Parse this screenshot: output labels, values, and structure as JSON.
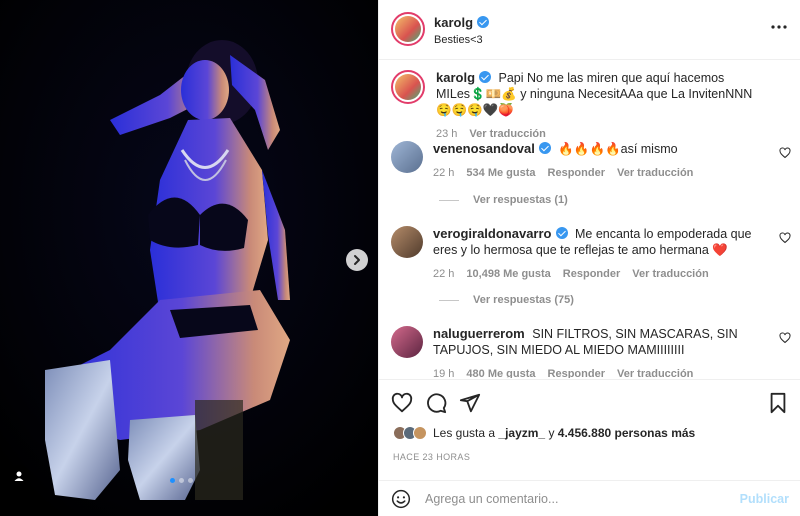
{
  "post": {
    "author": "karolg",
    "subtitle": "Besties<3",
    "caption_text": "Papi No me las miren que aquí hacemos MILes💲💴💰 y ninguna NecesitAAa que La InvitenNNN 🤤🤤🤤🖤🍑",
    "caption_time": "23 h",
    "translate_label": "Ver traducción"
  },
  "comments": [
    {
      "user": "venenosandoval",
      "text": "🔥🔥🔥🔥así mismo",
      "time": "22 h",
      "likes": "534 Me gusta",
      "reply_label": "Responder",
      "translate_label": "Ver traducción",
      "replies_label": "Ver respuestas (1)"
    },
    {
      "user": "verogiraldonavarro",
      "text": "Me encanta lo empoderada que eres y lo hermosa que te reflejas te amo hermana ❤️",
      "time": "22 h",
      "likes": "10,498 Me gusta",
      "reply_label": "Responder",
      "translate_label": "Ver traducción",
      "replies_label": "Ver respuestas (75)"
    },
    {
      "user": "naluguerrerom",
      "text": "SIN FILTROS, SIN MASCARAS, SIN TAPUJOS, SIN MIEDO AL MIEDO MAMIIIIIIII",
      "time": "19 h",
      "likes": "480 Me gusta",
      "reply_label": "Responder",
      "translate_label": "Ver traducción"
    }
  ],
  "likes": {
    "prefix": "Les gusta a",
    "user": "_jayzm_",
    "conj": "y",
    "others": "4.456.880 personas más"
  },
  "time_ago": "HACE 23 HORAS",
  "add_comment": {
    "placeholder": "Agrega un comentario...",
    "publish_label": "Publicar"
  },
  "icons": {
    "more": "more-horizontal-icon",
    "heart": "heart-icon",
    "comment": "comment-bubble-icon",
    "share": "paper-plane-icon",
    "save": "bookmark-icon",
    "next": "chevron-right-icon",
    "tag": "user-tag-icon",
    "emoji": "emoji-smile-icon",
    "verified": "verified-badge-icon"
  },
  "colors": {
    "verified": "#3897f0",
    "muted": "#8e8e8e",
    "publish_disabled": "#b2dffc",
    "carousel_active": "#1e90ff"
  },
  "carousel": {
    "slides": 3,
    "active_slide": 1
  }
}
